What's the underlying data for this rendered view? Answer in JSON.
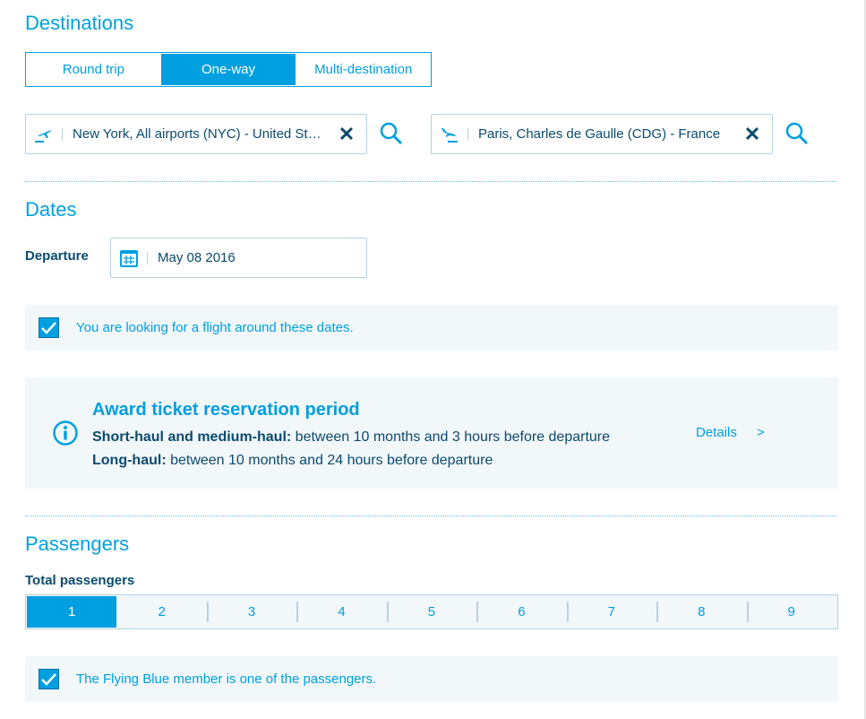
{
  "destinations": {
    "title": "Destinations",
    "trip_types": [
      "Round trip",
      "One-way",
      "Multi-destination"
    ],
    "selected_trip_type": "One-way",
    "origin": {
      "value": "New York, All airports (NYC) - United St…",
      "icon": "plane-takeoff-icon"
    },
    "destination": {
      "value": "Paris, Charles de Gaulle (CDG) - France",
      "icon": "plane-landing-icon"
    }
  },
  "dates": {
    "title": "Dates",
    "departure_label": "Departure",
    "departure_value": "May 08 2016",
    "flexible_label": "You are looking for a flight around these dates.",
    "flexible_checked": true
  },
  "info": {
    "title": "Award ticket reservation period",
    "line1_bold": "Short-haul and medium-haul:",
    "line1": " between 10 months and 3 hours before departure",
    "line2_bold": "Long-haul:",
    "line2": " between 10 months and 24 hours before departure",
    "details": "Details",
    "details_arrow": ">"
  },
  "passengers": {
    "title": "Passengers",
    "total_label": "Total passengers",
    "options": [
      "1",
      "2",
      "3",
      "4",
      "5",
      "6",
      "7",
      "8",
      "9"
    ],
    "selected": "1",
    "member_label": "The Flying Blue member is one of the passengers.",
    "member_checked": true
  },
  "colors": {
    "accent": "#009fe0",
    "text": "#0b4a6e",
    "panel": "#f2f7fa"
  }
}
